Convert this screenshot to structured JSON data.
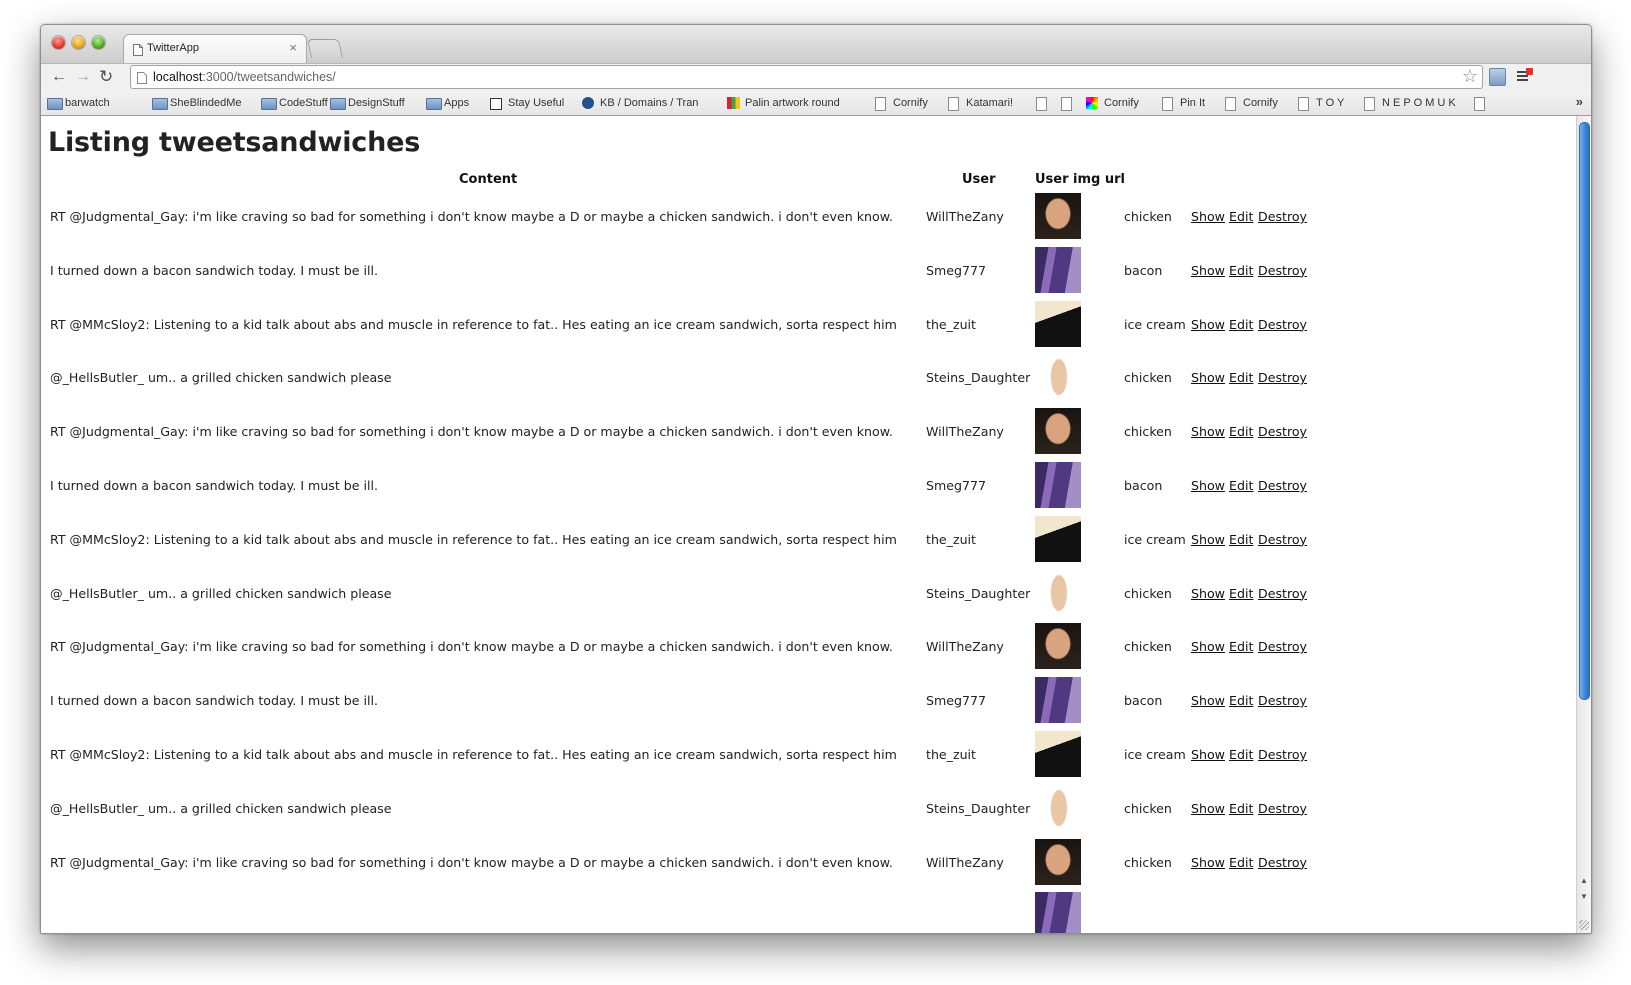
{
  "browser": {
    "tab_title": "TwitterApp",
    "tab_close": "×",
    "url_host": "localhost",
    "url_path": ":3000/tweetsandwiches/",
    "bookmarks": [
      {
        "label": "barwatch",
        "icon": "folder-icon"
      },
      {
        "label": "SheBlindedMe",
        "icon": "folder-icon"
      },
      {
        "label": "CodeStuff",
        "icon": "folder-icon"
      },
      {
        "label": "DesignStuff",
        "icon": "folder-icon"
      },
      {
        "label": "Apps",
        "icon": "folder-icon"
      },
      {
        "label": "Stay Useful",
        "icon": "checkbox-icon"
      },
      {
        "label": "KB / Domains / Tran",
        "icon": "moon-icon"
      },
      {
        "label": "Palin artwork round",
        "icon": "image-icon"
      },
      {
        "label": "Cornify",
        "icon": "page-icon"
      },
      {
        "label": "Katamari!",
        "icon": "page-icon"
      },
      {
        "label": "",
        "icon": "page-icon"
      },
      {
        "label": "",
        "icon": "page-icon"
      },
      {
        "label": "Cornify",
        "icon": "rainbow-icon"
      },
      {
        "label": "Pin It",
        "icon": "page-icon"
      },
      {
        "label": "Cornify",
        "icon": "page-icon"
      },
      {
        "label": "T O Y",
        "icon": "page-icon"
      },
      {
        "label": "N E P O M U K",
        "icon": "page-icon"
      },
      {
        "label": "",
        "icon": "page-icon"
      }
    ],
    "bookmarks_overflow": "»"
  },
  "page": {
    "title": "Listing tweetsandwiches",
    "headers": {
      "content": "Content",
      "user": "User",
      "user_img_url": "User img url"
    },
    "actions": {
      "show": "Show",
      "edit": "Edit",
      "destroy": "Destroy"
    },
    "rows": [
      {
        "content": "RT @Judgmental_Gay: i'm like craving so bad for something i don't know maybe a D or maybe a chicken sandwich. i don't even know.",
        "user": "WillTheZany",
        "avatar": "will",
        "sandwich": "chicken"
      },
      {
        "content": "I turned down a bacon sandwich today. I must be ill.",
        "user": "Smeg777",
        "avatar": "smeg",
        "sandwich": "bacon"
      },
      {
        "content": "RT @MMcSloy2: Listening to a kid talk about abs and muscle in reference to fat.. Hes eating an ice cream sandwich, sorta respect him",
        "user": "the_zuit",
        "avatar": "zuit",
        "sandwich": "ice cream"
      },
      {
        "content": "@_HellsButler_ um.. a grilled chicken sandwich please",
        "user": "Steins_Daughter",
        "avatar": "steins",
        "sandwich": "chicken"
      },
      {
        "content": "RT @Judgmental_Gay: i'm like craving so bad for something i don't know maybe a D or maybe a chicken sandwich. i don't even know.",
        "user": "WillTheZany",
        "avatar": "will",
        "sandwich": "chicken"
      },
      {
        "content": "I turned down a bacon sandwich today. I must be ill.",
        "user": "Smeg777",
        "avatar": "smeg",
        "sandwich": "bacon"
      },
      {
        "content": "RT @MMcSloy2: Listening to a kid talk about abs and muscle in reference to fat.. Hes eating an ice cream sandwich, sorta respect him",
        "user": "the_zuit",
        "avatar": "zuit",
        "sandwich": "ice cream"
      },
      {
        "content": "@_HellsButler_ um.. a grilled chicken sandwich please",
        "user": "Steins_Daughter",
        "avatar": "steins",
        "sandwich": "chicken"
      },
      {
        "content": "RT @Judgmental_Gay: i'm like craving so bad for something i don't know maybe a D or maybe a chicken sandwich. i don't even know.",
        "user": "WillTheZany",
        "avatar": "will",
        "sandwich": "chicken"
      },
      {
        "content": "I turned down a bacon sandwich today. I must be ill.",
        "user": "Smeg777",
        "avatar": "smeg",
        "sandwich": "bacon"
      },
      {
        "content": "RT @MMcSloy2: Listening to a kid talk about abs and muscle in reference to fat.. Hes eating an ice cream sandwich, sorta respect him",
        "user": "the_zuit",
        "avatar": "zuit",
        "sandwich": "ice cream"
      },
      {
        "content": "@_HellsButler_ um.. a grilled chicken sandwich please",
        "user": "Steins_Daughter",
        "avatar": "steins",
        "sandwich": "chicken"
      },
      {
        "content": "RT @Judgmental_Gay: i'm like craving so bad for something i don't know maybe a D or maybe a chicken sandwich. i don't even know.",
        "user": "WillTheZany",
        "avatar": "will",
        "sandwich": "chicken"
      },
      {
        "content": "",
        "user": "",
        "avatar": "smeg",
        "sandwich": ""
      }
    ]
  }
}
